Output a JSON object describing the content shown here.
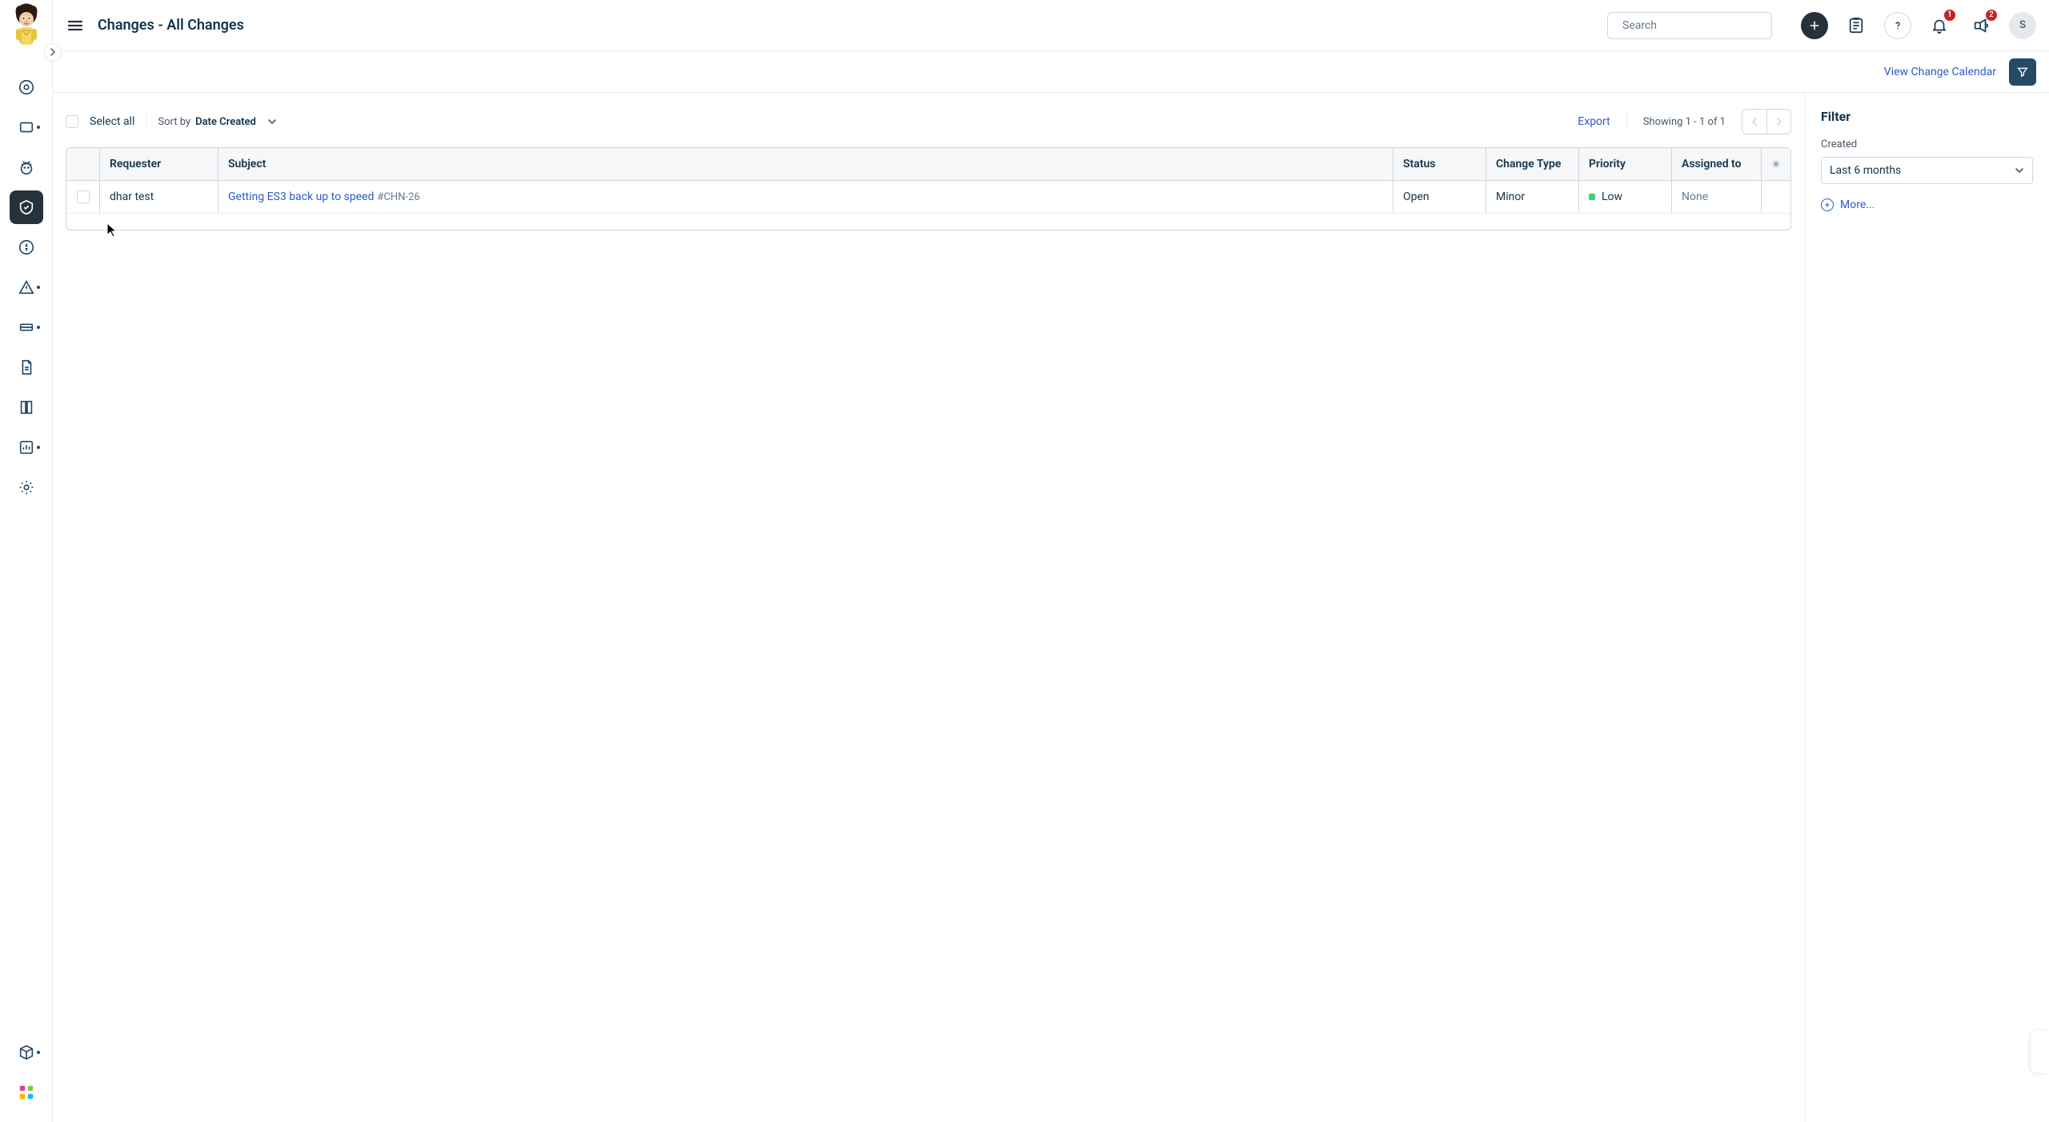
{
  "header": {
    "page_title": "Changes - All Changes",
    "search_placeholder": "Search",
    "avatar_initial": "S",
    "notif_badge": "1",
    "whatsnew_badge": "2"
  },
  "viewbar": {
    "calendar_link": "View Change Calendar"
  },
  "toolbar": {
    "select_all": "Select all",
    "sort_by_label": "Sort by",
    "sort_by_value": "Date Created",
    "export": "Export",
    "showing": "Showing 1 - 1 of 1"
  },
  "table": {
    "headers": {
      "requester": "Requester",
      "subject": "Subject",
      "status": "Status",
      "change_type": "Change Type",
      "priority": "Priority",
      "assigned_to": "Assigned to"
    },
    "rows": [
      {
        "requester": "dhar test",
        "subject_text": "Getting ES3 back up to speed",
        "subject_id": "#CHN-26",
        "status": "Open",
        "change_type": "Minor",
        "priority": "Low",
        "assigned_to": "None"
      }
    ]
  },
  "filter": {
    "title": "Filter",
    "created_label": "Created",
    "created_value": "Last 6 months",
    "more": "More..."
  }
}
